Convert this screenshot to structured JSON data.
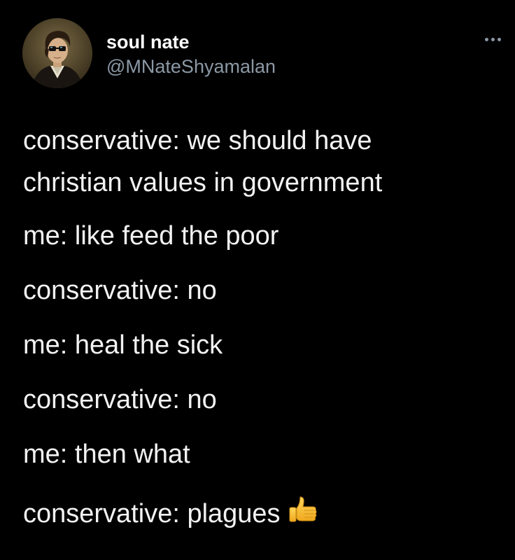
{
  "tweet": {
    "author": {
      "display_name": "soul nate",
      "handle": "@MNateShyamalan",
      "avatar": "avatar-painting"
    },
    "more_icon": "more-options-icon",
    "lines": [
      "conservative: we should have",
      "christian values in government",
      "me: like feed the poor",
      "conservative: no",
      "me: heal the sick",
      "conservative: no",
      "me: then what",
      "conservative: plagues"
    ],
    "trailing_emoji": "thumbs-up-emoji"
  },
  "colors": {
    "background": "#000000",
    "text": "#f2f2f2",
    "secondary": "#8b98a5"
  }
}
